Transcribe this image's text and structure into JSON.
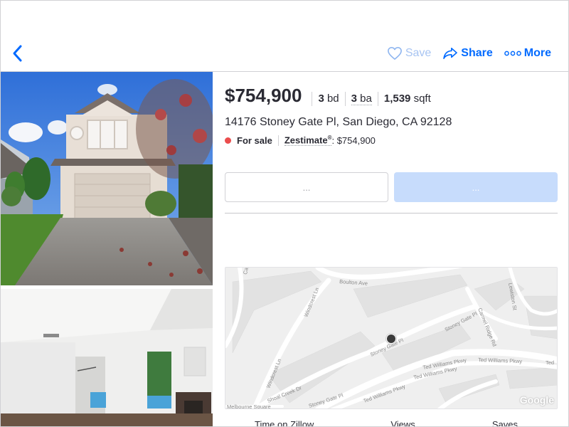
{
  "header": {
    "save_label": "Save",
    "share_label": "Share",
    "more_label": "More",
    "accent": "#006aff"
  },
  "listing": {
    "price": "$754,900",
    "beds_num": "3",
    "beds_unit": "bd",
    "baths_num": "3",
    "baths_unit": "ba",
    "sqft_num": "1,539",
    "sqft_unit": "sqft",
    "address": "14176 Stoney Gate Pl, San Diego, CA 92128",
    "status": "For sale",
    "status_color": "#eb4d4d",
    "zestimate_label": "Zestimate",
    "zestimate_mark": "®",
    "zestimate_value": ": $754,900"
  },
  "buttons": {
    "left_label": "...",
    "right_label": "..."
  },
  "map": {
    "streets": [
      "Boulton Ave",
      "Windcrest Ln",
      "Windcrest Ln",
      "Stoney Gate Pl",
      "Stoney Gate Pl",
      "Carmel Ridge Rd",
      "Lewiston St",
      "Ted Williams Pkwy",
      "Ted Williams Pkwy",
      "Ted Williams Pkwy",
      "Ted Williams Pkwy",
      "Ted",
      "Shoal Creek Dr",
      "Stoney Gate Pl",
      "Melbourne Square",
      "Cap"
    ],
    "attribution": "Google"
  },
  "stats": {
    "time_label": "Time on Zillow",
    "views_label": "Views",
    "saves_label": "Saves"
  }
}
